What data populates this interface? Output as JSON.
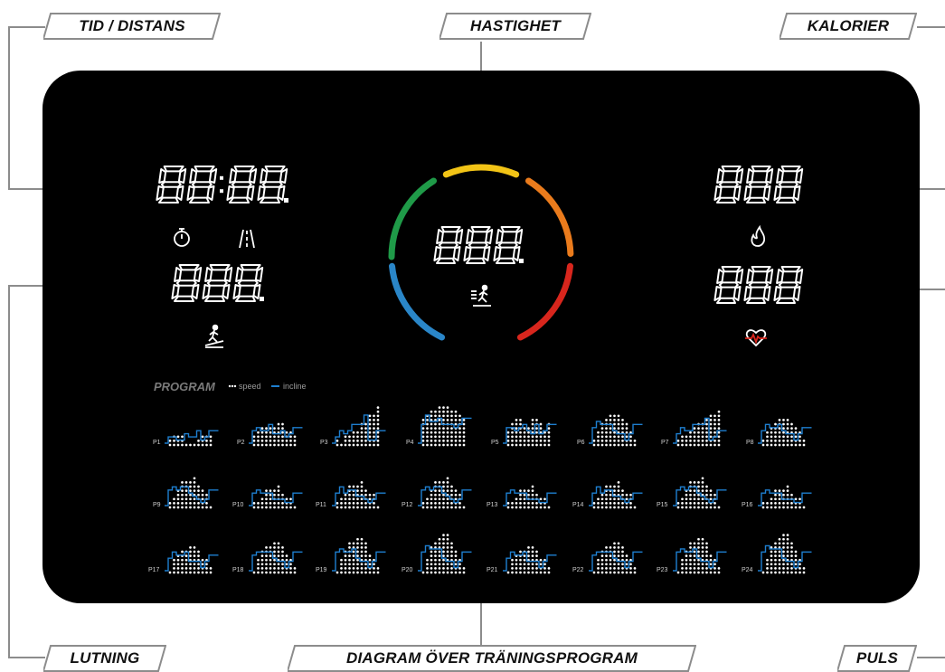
{
  "callouts": {
    "time_distance": "TID / DISTANS",
    "speed": "HASTIGHET",
    "calories": "KALORIER",
    "incline": "LUTNING",
    "program_chart": "DIAGRAM ÖVER TRÄNINGSPROGRAM",
    "pulse": "PULS"
  },
  "display": {
    "time_distance_digits": "88:88.",
    "incline_digits": "888.",
    "speed_digits": "888.",
    "calories_digits": "888",
    "pulse_digits": "888"
  },
  "program_legend": {
    "title": "PROGRAM",
    "speed_label": "speed",
    "incline_label": "incline"
  },
  "programs": [
    "P1",
    "P2",
    "P3",
    "P4",
    "P5",
    "P6",
    "P7",
    "P8",
    "P9",
    "P10",
    "P11",
    "P12",
    "P13",
    "P14",
    "P15",
    "P16",
    "P17",
    "P18",
    "P19",
    "P20",
    "P21",
    "P22",
    "P23",
    "P24"
  ],
  "colors": {
    "panel": "#000000",
    "segment": "#ffffff",
    "incline_line": "#1e7fd0",
    "ring_green": "#1f9a48",
    "ring_yellow": "#f2c416",
    "ring_orange": "#ea7b1c",
    "ring_red": "#d8261d",
    "ring_blue": "#2a86c8",
    "connector": "#8a8a8a"
  },
  "icons": [
    "timer-icon",
    "road-icon",
    "incline-runner-icon",
    "treadmill-runner-icon",
    "flame-icon",
    "heart-pulse-icon"
  ]
}
